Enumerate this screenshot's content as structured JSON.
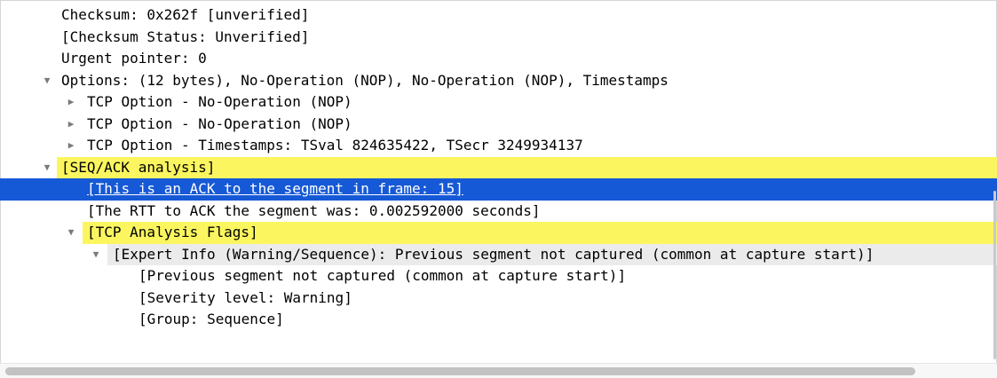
{
  "tree": {
    "rows": [
      {
        "text": "Checksum: 0x262f [unverified]",
        "twisty": "",
        "level": 0,
        "style": "normal"
      },
      {
        "text": "[Checksum Status: Unverified]",
        "twisty": "",
        "level": 0,
        "style": "normal"
      },
      {
        "text": "Urgent pointer: 0",
        "twisty": "",
        "level": 0,
        "style": "normal"
      },
      {
        "text": "Options: (12 bytes), No-Operation (NOP), No-Operation (NOP), Timestamps",
        "twisty": "▼",
        "level": 0,
        "style": "normal"
      },
      {
        "text": "TCP Option - No-Operation (NOP)",
        "twisty": "▶",
        "level": 1,
        "style": "normal"
      },
      {
        "text": "TCP Option - No-Operation (NOP)",
        "twisty": "▶",
        "level": 1,
        "style": "normal"
      },
      {
        "text": "TCP Option - Timestamps: TSval 824635422, TSecr 3249934137",
        "twisty": "▶",
        "level": 1,
        "style": "normal"
      },
      {
        "text": "[SEQ/ACK analysis]",
        "twisty": "▼",
        "level": 0,
        "style": "yellow"
      },
      {
        "text": "[This is an ACK to the segment in frame: 15]",
        "twisty": "",
        "level": 1,
        "style": "selected"
      },
      {
        "text": "[The RTT to ACK the segment was: 0.002592000 seconds]",
        "twisty": "",
        "level": 1,
        "style": "normal"
      },
      {
        "text": "[TCP Analysis Flags]",
        "twisty": "▼",
        "level": 1,
        "style": "yellow"
      },
      {
        "text": "[Expert Info (Warning/Sequence): Previous segment not captured (common at capture start)]",
        "twisty": "▼",
        "level": 2,
        "style": "grey"
      },
      {
        "text": "[Previous segment not captured (common at capture start)]",
        "twisty": "",
        "level": 3,
        "style": "normal"
      },
      {
        "text": "[Severity level: Warning]",
        "twisty": "",
        "level": 3,
        "style": "normal"
      },
      {
        "text": "[Group: Sequence]",
        "twisty": "",
        "level": 3,
        "style": "normal"
      }
    ]
  },
  "colors": {
    "highlight_yellow": "#fbf65f",
    "selection_blue": "#1659d6",
    "expert_grey": "#ebebeb"
  },
  "icons": {
    "expanded": "triangle-down-icon",
    "collapsed": "triangle-right-icon"
  }
}
